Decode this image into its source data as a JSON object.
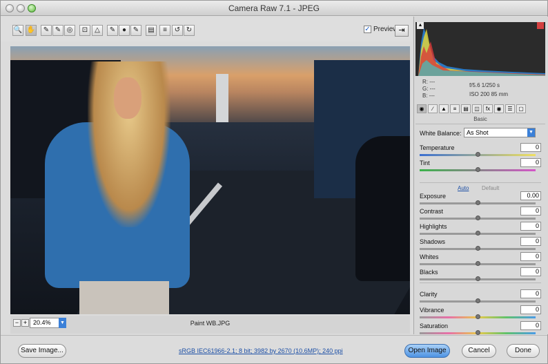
{
  "window": {
    "title": "Camera Raw 7.1  -  JPEG"
  },
  "toolbar": {
    "tools": [
      {
        "name": "zoom-tool-icon",
        "glyph": "🔍"
      },
      {
        "name": "hand-tool-icon",
        "glyph": "✋"
      },
      {
        "name": "white-balance-tool-icon",
        "glyph": "✎"
      },
      {
        "name": "color-sampler-tool-icon",
        "glyph": "✎"
      },
      {
        "name": "targeted-adjustment-tool-icon",
        "glyph": "◎"
      },
      {
        "name": "crop-tool-icon",
        "glyph": "⊡"
      },
      {
        "name": "straighten-tool-icon",
        "glyph": "△"
      },
      {
        "name": "spot-removal-tool-icon",
        "glyph": "✎"
      },
      {
        "name": "red-eye-tool-icon",
        "glyph": "●"
      },
      {
        "name": "adjustment-brush-icon",
        "glyph": "✎"
      },
      {
        "name": "graduated-filter-icon",
        "glyph": "▤"
      },
      {
        "name": "preferences-icon",
        "glyph": "≡"
      },
      {
        "name": "rotate-left-icon",
        "glyph": "↺"
      },
      {
        "name": "rotate-right-icon",
        "glyph": "↻"
      }
    ],
    "preview_label": "Preview",
    "preview_checked": true
  },
  "image": {
    "filename": "Paint WB.JPG",
    "zoom": "20.4%"
  },
  "histogram": {
    "r": "R:  ---",
    "g": "G:  ---",
    "b": "B:  ---",
    "aperture_shutter": "f/5.6   1/250 s",
    "iso_lens": "ISO 200   85 mm"
  },
  "panel": {
    "section": "Basic",
    "white_balance_label": "White Balance:",
    "white_balance_value": "As Shot",
    "auto_label": "Auto",
    "default_label": "Default",
    "sliders": [
      {
        "label": "Temperature",
        "value": "0",
        "pos": 0.5
      },
      {
        "label": "Tint",
        "value": "0",
        "pos": 0.5
      },
      {
        "label": "Exposure",
        "value": "0.00",
        "pos": 0.5
      },
      {
        "label": "Contrast",
        "value": "0",
        "pos": 0.5
      },
      {
        "label": "Highlights",
        "value": "0",
        "pos": 0.5
      },
      {
        "label": "Shadows",
        "value": "0",
        "pos": 0.5
      },
      {
        "label": "Whites",
        "value": "0",
        "pos": 0.5
      },
      {
        "label": "Blacks",
        "value": "0",
        "pos": 0.5
      },
      {
        "label": "Clarity",
        "value": "0",
        "pos": 0.5
      },
      {
        "label": "Vibrance",
        "value": "0",
        "pos": 0.5
      },
      {
        "label": "Saturation",
        "value": "0",
        "pos": 0.5
      }
    ]
  },
  "bottom": {
    "save_label": "Save Image...",
    "workflow_info": "sRGB IEC61966-2.1; 8 bit; 3982 by 2670 (10.6MP); 240 ppi",
    "open_label": "Open Image",
    "cancel_label": "Cancel",
    "done_label": "Done"
  }
}
